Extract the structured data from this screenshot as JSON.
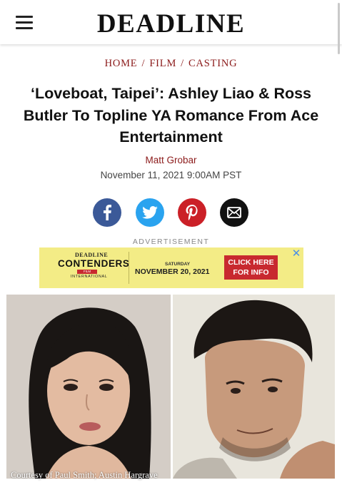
{
  "header": {
    "menu_icon": "hamburger-menu-icon",
    "logo_text": "DEADLINE"
  },
  "breadcrumb": {
    "items": [
      "HOME",
      "FILM",
      "CASTING"
    ],
    "separator": "/"
  },
  "article": {
    "headline": "‘Loveboat, Taipei’: Ashley Liao & Ross Butler To Topline YA Romance From Ace Entertainment",
    "author": "Matt Grobar",
    "date": "November 11, 2021 9:00AM PST"
  },
  "share": {
    "buttons": [
      {
        "icon": "facebook-icon",
        "color": "#3b5998"
      },
      {
        "icon": "twitter-icon",
        "color": "#2aa3ef"
      },
      {
        "icon": "pinterest-icon",
        "color": "#cb2027"
      },
      {
        "icon": "email-icon",
        "color": "#111111"
      }
    ]
  },
  "ad": {
    "label": "ADVERTISEMENT",
    "brand_top": "DEADLINE",
    "brand_name": "CONTENDERS",
    "brand_sub": "FILM",
    "brand_intl": "INTERNATIONAL",
    "day": "SATURDAY",
    "date": "NOVEMBER 20, 2021",
    "cta_line1": "CLICK HERE",
    "cta_line2": "FOR INFO",
    "close_icon": "close-icon",
    "bg_color": "#f3ec86",
    "cta_color": "#c8292f"
  },
  "photos": {
    "left_alt": "Ashley Liao",
    "right_alt": "Ross Butler",
    "caption": "Courtesy of Paul Smith; Austin Hargrave"
  },
  "colors": {
    "accent": "#8b1a1a",
    "text": "#111111"
  }
}
